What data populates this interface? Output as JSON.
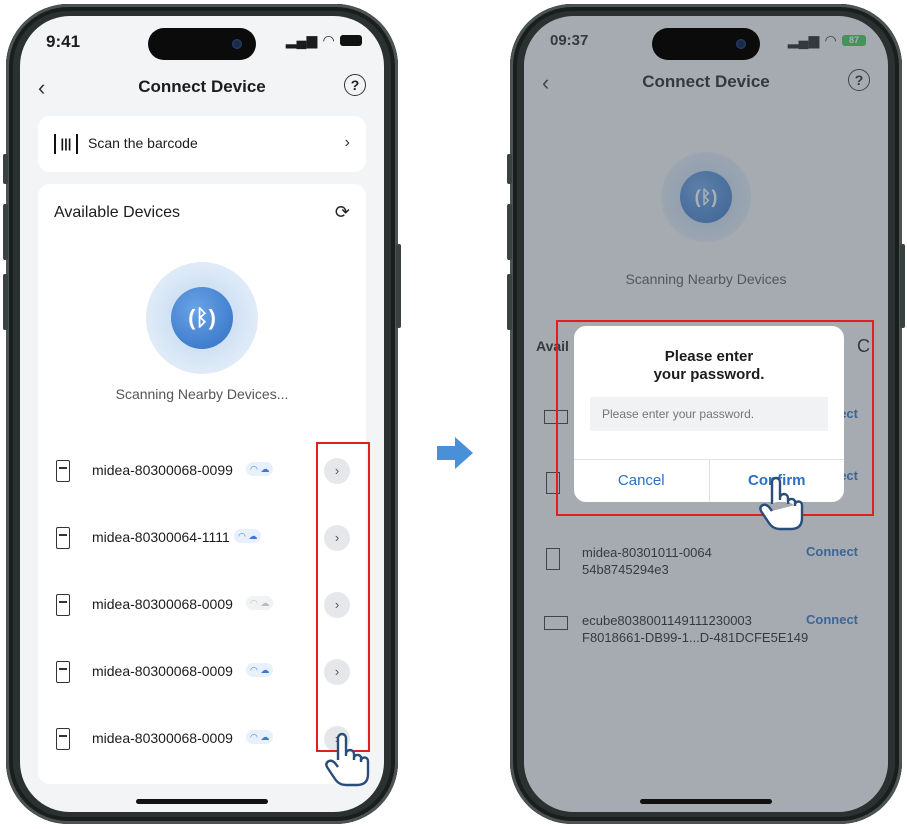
{
  "phone1": {
    "status_time": "9:41",
    "nav_title": "Connect Device",
    "scan_label": "Scan the barcode",
    "available_header": "Available Devices",
    "scanning_text": "Scanning Nearby Devices...",
    "devices": [
      {
        "name": "midea-80300068-0099",
        "badge": "wifi + cloud"
      },
      {
        "name": "midea-80300064-1111",
        "badge": "wifi + cloud"
      },
      {
        "name": "midea-80300068-0009",
        "badge": "wifi + cloud"
      },
      {
        "name": "midea-80300068-0009",
        "badge": "wifi + cloud"
      },
      {
        "name": "midea-80300068-0009",
        "badge": "wifi + cloud"
      }
    ]
  },
  "phone2": {
    "status_time": "09:37",
    "battery": "87",
    "nav_title": "Connect Device",
    "scanning_text": "Scanning Nearby Devices",
    "available_header_partial": "Avail",
    "dialog": {
      "title_line1": "Please enter",
      "title_line2": "your password.",
      "input_placeholder": "Please enter your password.",
      "cancel": "Cancel",
      "confirm": "Confirm"
    },
    "rows": [
      {
        "line1": "midea-80301011-0064",
        "line2": "54b8745294e3",
        "action": "Connect"
      },
      {
        "line1": "ecube8038001149111230003",
        "line2": "F8018661-DB99-1...D-481DCFE5E149",
        "action": "Connect"
      }
    ],
    "hidden_connect_labels": [
      "ect",
      "ect"
    ]
  },
  "icons": {
    "back": "‹",
    "help": "?",
    "scan": "[|||]",
    "chevron": "›",
    "refresh": "⟳",
    "bluetooth": "(ᛒ)"
  },
  "colors": {
    "accent": "#2d6fc1",
    "highlight": "#e02020",
    "arrow": "#4a90d9"
  }
}
